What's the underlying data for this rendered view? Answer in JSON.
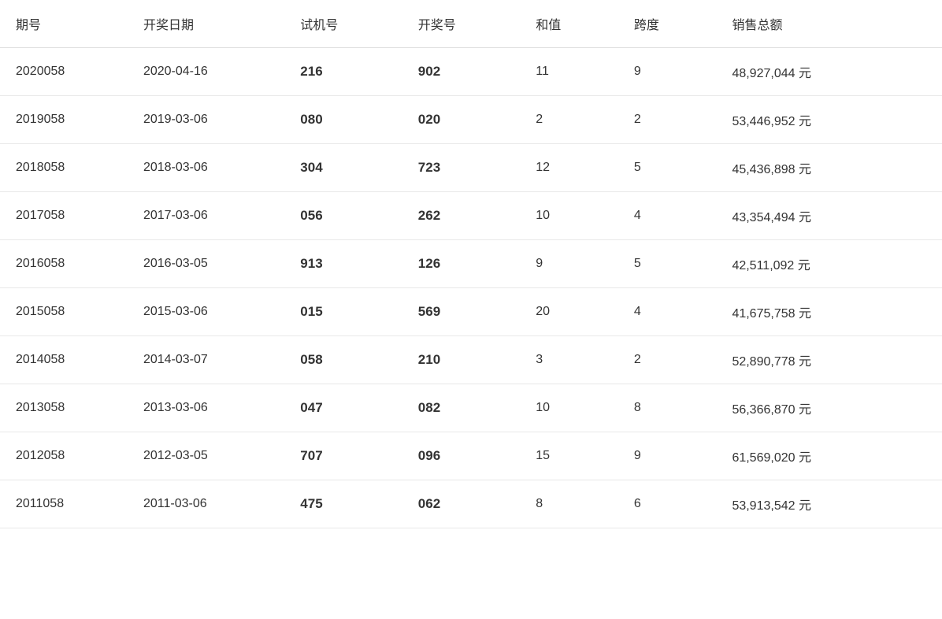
{
  "table": {
    "headers": [
      "期号",
      "开奖日期",
      "试机号",
      "开奖号",
      "和值",
      "跨度",
      "销售总额"
    ],
    "rows": [
      {
        "id": "2020058",
        "date": "2020-04-16",
        "trial": "216",
        "winning": "902",
        "sum": "11",
        "span": "9",
        "sales": "48,927,044 元"
      },
      {
        "id": "2019058",
        "date": "2019-03-06",
        "trial": "080",
        "winning": "020",
        "sum": "2",
        "span": "2",
        "sales": "53,446,952 元"
      },
      {
        "id": "2018058",
        "date": "2018-03-06",
        "trial": "304",
        "winning": "723",
        "sum": "12",
        "span": "5",
        "sales": "45,436,898 元"
      },
      {
        "id": "2017058",
        "date": "2017-03-06",
        "trial": "056",
        "winning": "262",
        "sum": "10",
        "span": "4",
        "sales": "43,354,494 元"
      },
      {
        "id": "2016058",
        "date": "2016-03-05",
        "trial": "913",
        "winning": "126",
        "sum": "9",
        "span": "5",
        "sales": "42,511,092 元"
      },
      {
        "id": "2015058",
        "date": "2015-03-06",
        "trial": "015",
        "winning": "569",
        "sum": "20",
        "span": "4",
        "sales": "41,675,758 元"
      },
      {
        "id": "2014058",
        "date": "2014-03-07",
        "trial": "058",
        "winning": "210",
        "sum": "3",
        "span": "2",
        "sales": "52,890,778 元"
      },
      {
        "id": "2013058",
        "date": "2013-03-06",
        "trial": "047",
        "winning": "082",
        "sum": "10",
        "span": "8",
        "sales": "56,366,870 元"
      },
      {
        "id": "2012058",
        "date": "2012-03-05",
        "trial": "707",
        "winning": "096",
        "sum": "15",
        "span": "9",
        "sales": "61,569,020 元"
      },
      {
        "id": "2011058",
        "date": "2011-03-06",
        "trial": "475",
        "winning": "062",
        "sum": "8",
        "span": "6",
        "sales": "53,913,542 元"
      }
    ]
  }
}
